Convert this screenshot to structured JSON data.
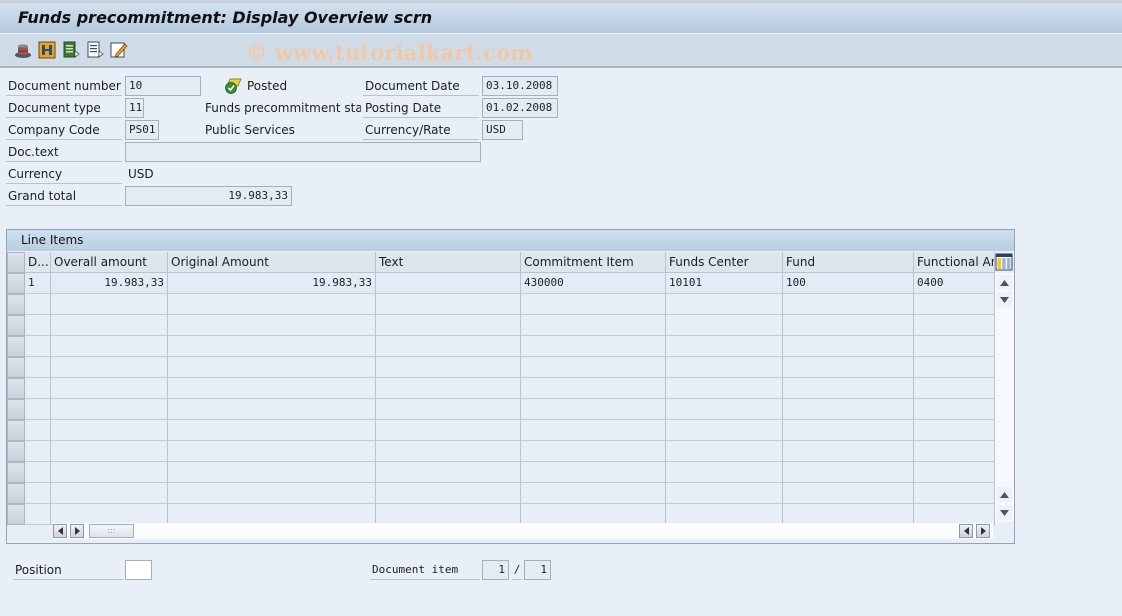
{
  "window": {
    "title": "Funds precommitment: Display Overview scrn",
    "watermark": "© www.tutorialkart.com"
  },
  "toolbar": {
    "icons": [
      "hat-icon",
      "structure-icon",
      "green-doc-arrow-icon",
      "doc-arrow-icon",
      "edit-pencil-icon"
    ]
  },
  "header": {
    "document_number": {
      "label": "Document number",
      "value": "10"
    },
    "status": {
      "icon": "posted-check-icon",
      "text": "Posted"
    },
    "document_type": {
      "label": "Document type",
      "value": "11",
      "description": "Funds precommitment sta..."
    },
    "company_code": {
      "label": "Company Code",
      "value": "PS01",
      "description": "Public Services"
    },
    "doc_text": {
      "label": "Doc.text",
      "value": ""
    },
    "currency": {
      "label": "Currency",
      "value": "USD"
    },
    "grand_total": {
      "label": "Grand total",
      "value": "19.983,33"
    },
    "document_date": {
      "label": "Document Date",
      "value": "03.10.2008"
    },
    "posting_date": {
      "label": "Posting Date",
      "value": "01.02.2008"
    },
    "currency_rate": {
      "label": "Currency/Rate",
      "value": "USD"
    }
  },
  "line_items": {
    "title": "Line Items",
    "columns": [
      "D...",
      "Overall amount",
      "Original Amount",
      "Text",
      "Commitment Item",
      "Funds Center",
      "Fund",
      "Functional Are"
    ],
    "rows": [
      [
        "1",
        "19.983,33",
        "19.983,33",
        "",
        "430000",
        "10101",
        "100",
        "0400"
      ]
    ],
    "empty_rows": 11
  },
  "footer": {
    "position": {
      "label": "Position",
      "value": ""
    },
    "document_item": {
      "label": "Document item",
      "current": "1",
      "separator": "/",
      "total": "1"
    }
  }
}
